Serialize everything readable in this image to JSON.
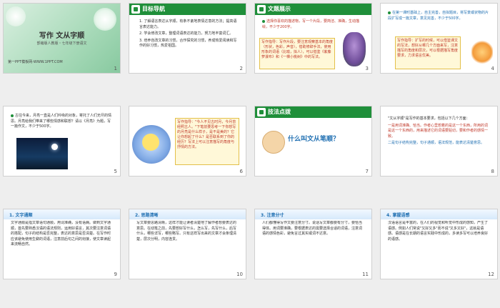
{
  "slides": [
    {
      "number": "1",
      "title": "写作 文从字顺",
      "subtitle": "部编版人教版・七年级下册语文",
      "footer": "第一PPT模板网-WWW.1PPT.COM"
    },
    {
      "number": "2",
      "header": "目标导航",
      "items": [
        "1. 了解语言表达从字顺，有条不紊地表情达意的方法；提高语言表达能力。",
        "2. 学会修改文章，整理词语表达的能力，努力地丰富词汇。",
        "3. 培养自改文章的习惯，合作探究的习惯，养成热爱阅读和写作的好习惯，热爱祖国。"
      ]
    },
    {
      "number": "3",
      "header": "文题展示",
      "items": [
        "选择你喜欢的描述物，写一个片段，要简洁、准确，生动描绘，不少于200字。"
      ],
      "note": "写作指导：写作片段，要注意观察基本的角度（形状，色彩，声音），借助修辞手法，使用形象的词语（比喻，拟人），可以借鉴《紫藤萝瀑布》和《一棵小桃树》中的写法。"
    },
    {
      "number": "4",
      "items": [
        "在第一课时基础上，自主完善，自拟题目，将写景或状物的片段扩写成一篇文章，意见完善，不少于500字。"
      ],
      "note": "写作指导：扩写的时候，可以借鉴课文的写法，想好从哪几个方面来写，注意描写的角度和层次，可以根据描写角度要求，力求语言优美。"
    },
    {
      "number": "5",
      "items": [
        "古往今来，月亮一直是人们吟咏的对象，寄托了人们无尽的情思。月亮给我们带来了哪些情感和联想？请以《月亮》为题，写一篇作文，不少于500字。"
      ]
    },
    {
      "number": "6",
      "note": "写作指导：\"今人不见古时月，今月曾经照古人。\"下笔前要思考一下你想写的月亮是什么样子，是不是美的？它让你想起了什么？是否联系到了你的经历？写法上可以注意描写的角度与抒情的方法。"
    },
    {
      "number": "7",
      "header": "技法点拨",
      "question": "什么叫文从笔顺？"
    },
    {
      "number": "8",
      "items": [
        "\"文从字顺\"是写作的基本要求，包括以下几个方面：",
        "一是用词准确、恰当。作者心里想着的是这一个东西，所用的词是这一个东西的，用来描述它的词语要贴切，要和作者的感情一致。",
        "二是句子结构完整，句子通顺，语法规范，能表达清楚意思。"
      ]
    },
    {
      "number": "9",
      "header": "1. 文字通顺",
      "body": "文字通顺是指文章语句通顺，用词准确，没有语病。做到文字通顺，首先要熟悉汉语的语法规则，运用好语言，其次要注意词语的搭配，句子的结构是否完整，表达的意思是否清楚。在写作时应该避免使用生僻的词语，注意前后句之间的衔接，使文章读起来流畅自然。"
    },
    {
      "number": "10",
      "header": "2. 思路清晰",
      "body": "写文章要思路清晰，这样才能让读者清楚地了解作者想要表达的意思。在动笔之前，先要想好写什么，怎么写，先写什么，后写什么，哪些详写，哪些略写。只有这样写出来的文章才会条理清楚，层次分明，内容连贯。"
    },
    {
      "number": "11",
      "header": "3. 注意分寸",
      "body": "人们都懂得写作文要注意分寸。说话写文章都要有分寸，要恰当得体。用词要准确，要根据表达的需要选择合适的词语，注意词语的感情色彩，避免言过其实或词不达意。"
    },
    {
      "number": "12",
      "header": "4. 掌握语感",
      "body": "汉语语言是丰富的，在人们的视觉和听觉中形成的感知，产生了语感。例如人们常说\"又好又多\"而不说\"又多又好\"，这就是语感。语感是在长期的语言实践中形成的，多读多写可以培养良好的语感。"
    }
  ]
}
